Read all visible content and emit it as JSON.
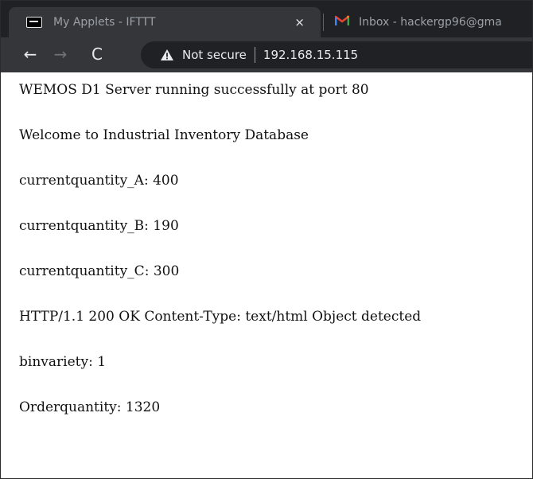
{
  "browser": {
    "tabs": [
      {
        "title": "My Applets - IFTTT",
        "favicon": "ifttt-icon",
        "active": true,
        "close_label": "×"
      },
      {
        "title": "Inbox - hackergp96@gma",
        "favicon": "gmail-icon",
        "active": false
      }
    ],
    "nav": {
      "back": "←",
      "forward": "→",
      "reload": "C"
    },
    "address_bar": {
      "security_label": "Not secure",
      "url": "192.168.15.115"
    }
  },
  "page": {
    "lines": [
      "WEMOS D1 Server running successfully at port 80",
      "Welcome to Industrial Inventory Database",
      "currentquantity_A: 400",
      "currentquantity_B: 190",
      "currentquantity_C: 300",
      "HTTP/1.1 200 OK Content-Type: text/html Object detected",
      "binvariety: 1",
      "Orderquantity: 1320"
    ]
  }
}
